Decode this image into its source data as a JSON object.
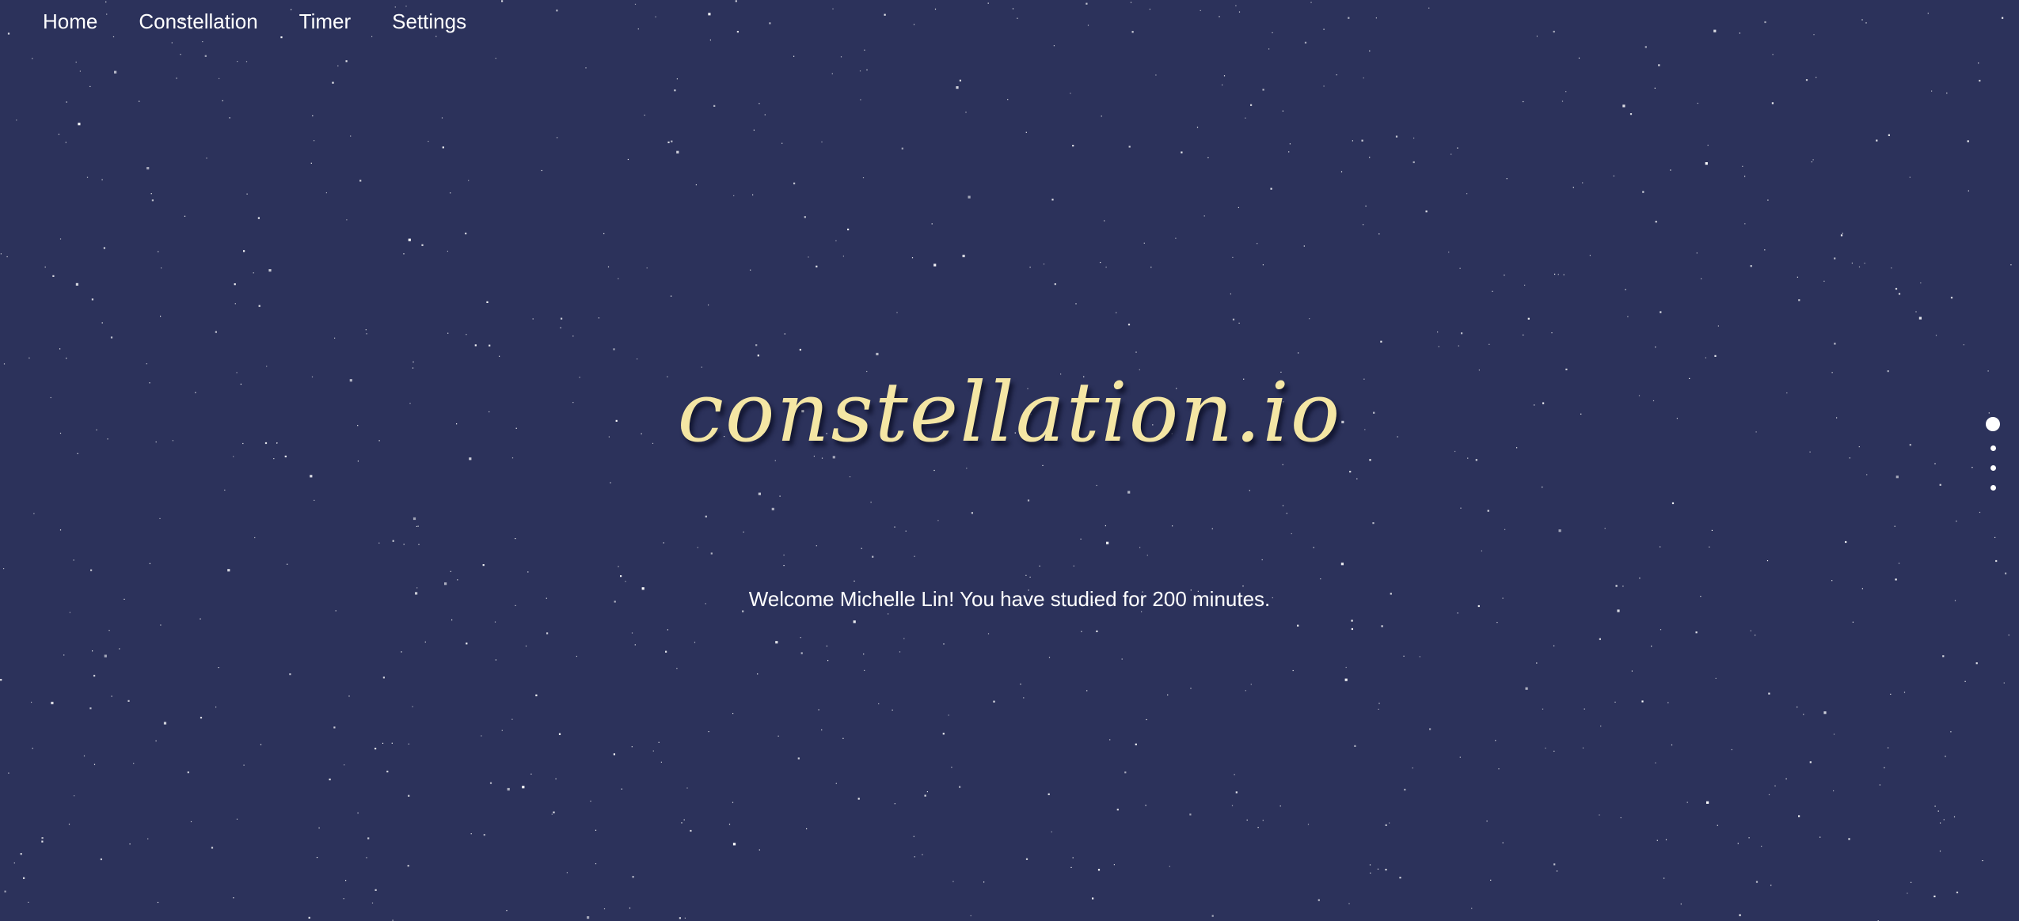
{
  "colors": {
    "background": "#2c325b",
    "logo": "#f4e6a4",
    "text": "#ffffff",
    "star": "#ffffff"
  },
  "nav": {
    "items": [
      {
        "label": "Home"
      },
      {
        "label": "Constellation"
      },
      {
        "label": "Timer"
      },
      {
        "label": "Settings"
      }
    ]
  },
  "hero": {
    "logo_text": "constellation.io",
    "welcome_text": "Welcome Michelle Lin! You have studied for 200 minutes."
  },
  "pager": {
    "count": 4,
    "active_index": 0
  }
}
